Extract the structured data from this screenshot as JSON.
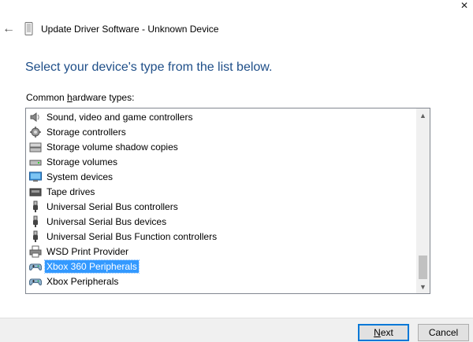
{
  "window": {
    "title": "Update Driver Software - Unknown Device",
    "close_glyph": "✕",
    "back_glyph": "←"
  },
  "heading": "Select your device's type from the list below.",
  "list_label": {
    "prefix": "Common ",
    "accel": "h",
    "suffix": "ardware types:"
  },
  "items": [
    {
      "label": "Sound, video and game controllers",
      "icon": "speaker-icon"
    },
    {
      "label": "Storage controllers",
      "icon": "storage-controller-icon"
    },
    {
      "label": "Storage volume shadow copies",
      "icon": "shadow-copy-icon"
    },
    {
      "label": "Storage volumes",
      "icon": "storage-volume-icon"
    },
    {
      "label": "System devices",
      "icon": "system-device-icon"
    },
    {
      "label": "Tape drives",
      "icon": "tape-drive-icon"
    },
    {
      "label": "Universal Serial Bus controllers",
      "icon": "usb-icon"
    },
    {
      "label": "Universal Serial Bus devices",
      "icon": "usb-icon"
    },
    {
      "label": "Universal Serial Bus Function controllers",
      "icon": "usb-icon"
    },
    {
      "label": "WSD Print Provider",
      "icon": "printer-icon"
    },
    {
      "label": "Xbox 360 Peripherals",
      "icon": "gamepad-icon"
    },
    {
      "label": "Xbox Peripherals",
      "icon": "gamepad-icon"
    }
  ],
  "selected_item": "Xbox 360 Peripherals",
  "scrollbar": {
    "up_glyph": "▲",
    "down_glyph": "▼"
  },
  "buttons": {
    "next_accel": "N",
    "next_rest": "ext",
    "cancel": "Cancel"
  },
  "colors": {
    "heading": "#1e4e88",
    "selection": "#3399ff",
    "default_button_border": "#0078d7"
  }
}
